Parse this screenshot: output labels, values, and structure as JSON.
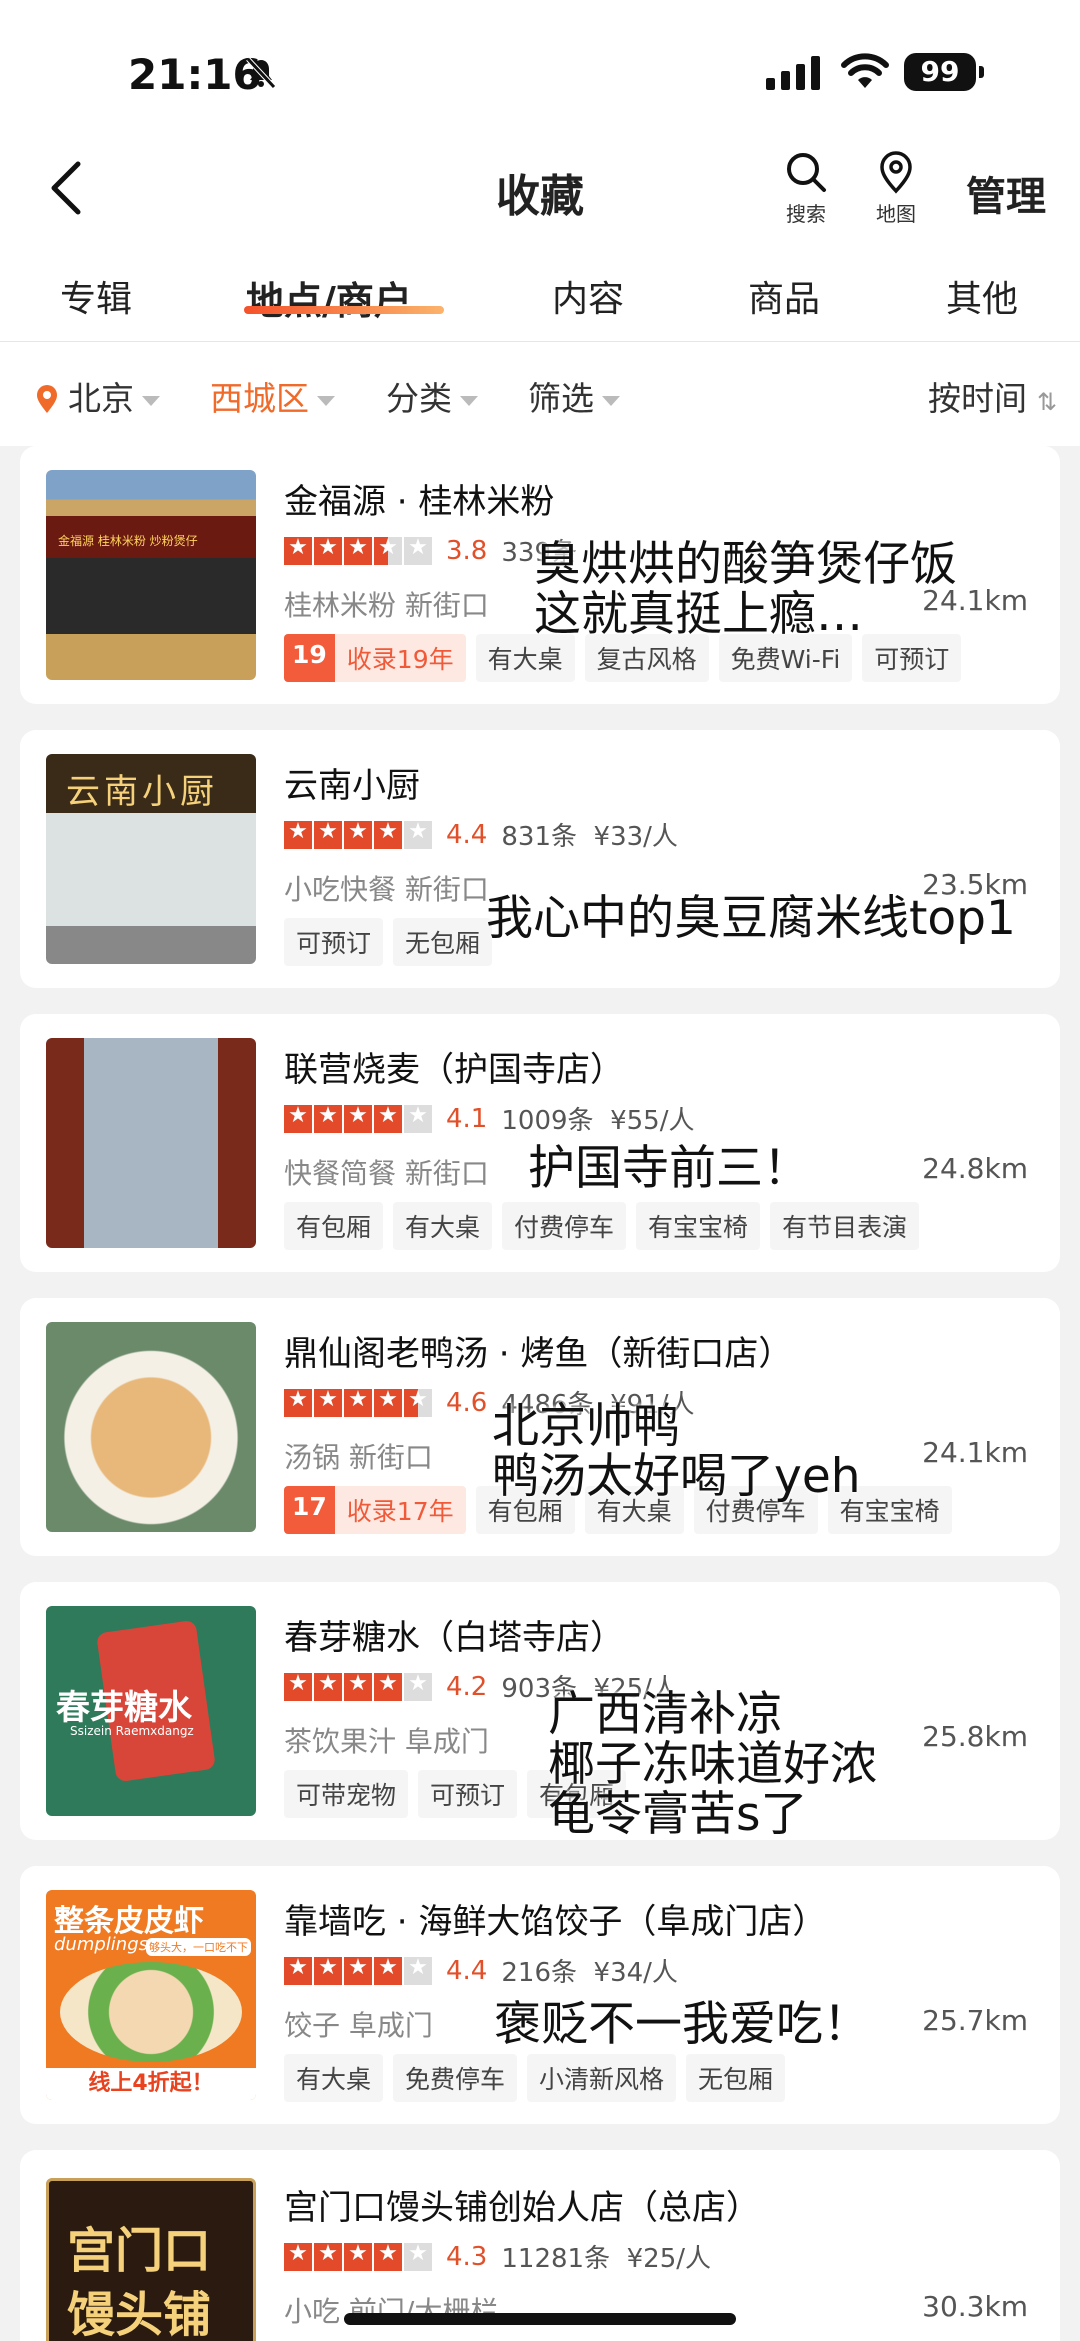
{
  "status": {
    "time": "21:16",
    "battery": "99"
  },
  "nav": {
    "title": "收藏",
    "search_label": "搜索",
    "map_label": "地图",
    "manage_label": "管理"
  },
  "tabs": [
    "专辑",
    "地点/商户",
    "内容",
    "商品",
    "其他"
  ],
  "active_tab": "地点/商户",
  "filters": {
    "city": "北京",
    "district": "西城区",
    "category": "分类",
    "filter": "筛选",
    "sort": "按时间"
  },
  "accent_color": "#f06a2a",
  "shops": [
    {
      "name": "金福源 · 桂林米粉",
      "score": "3.8",
      "stars": 3.5,
      "reviews": "339条",
      "price": "",
      "category_area": "桂林米粉 新街口",
      "distance": "24.1km",
      "years_num": "19",
      "years_text": "收录19年",
      "tags": [
        "有大桌",
        "复古风格",
        "免费Wi-Fi",
        "可预订"
      ],
      "overlay": [
        "臭烘烘的酸笋煲仔饭",
        "这就真挺上瘾…"
      ]
    },
    {
      "name": "云南小厨",
      "score": "4.4",
      "stars": 4,
      "reviews": "831条",
      "price": "¥33/人",
      "category_area": "小吃快餐 新街口",
      "distance": "23.5km",
      "years_num": "",
      "years_text": "",
      "tags": [
        "可预订",
        "无包厢"
      ],
      "overlay": [
        "我心中的臭豆腐米线top1"
      ]
    },
    {
      "name": "联营烧麦（护国寺店）",
      "score": "4.1",
      "stars": 4,
      "reviews": "1009条",
      "price": "¥55/人",
      "category_area": "快餐简餐 新街口",
      "distance": "24.8km",
      "years_num": "",
      "years_text": "",
      "tags": [
        "有包厢",
        "有大桌",
        "付费停车",
        "有宝宝椅",
        "有节目表演"
      ],
      "overlay": [
        "护国寺前三！"
      ]
    },
    {
      "name": "鼎仙阁老鸭汤 · 烤鱼（新街口店）",
      "score": "4.6",
      "stars": 4.5,
      "reviews": "4486条",
      "price": "¥91/人",
      "category_area": "汤锅 新街口",
      "distance": "24.1km",
      "years_num": "17",
      "years_text": "收录17年",
      "tags": [
        "有包厢",
        "有大桌",
        "付费停车",
        "有宝宝椅"
      ],
      "overlay": [
        "北京帅鸭",
        "鸭汤太好喝了yeh"
      ]
    },
    {
      "name": "春芽糖水（白塔寺店）",
      "score": "4.2",
      "stars": 4,
      "reviews": "903条",
      "price": "¥25/人",
      "category_area": "茶饮果汁 阜成门",
      "distance": "25.8km",
      "years_num": "",
      "years_text": "",
      "tags": [
        "可带宠物",
        "可预订",
        "有包厢"
      ],
      "overlay": [
        "广西清补凉",
        "椰子冻味道好浓",
        "龟苓膏苦s了"
      ]
    },
    {
      "name": "靠墙吃 · 海鲜大馅饺子（阜成门店）",
      "score": "4.4",
      "stars": 4,
      "reviews": "216条",
      "price": "¥34/人",
      "category_area": "饺子 阜成门",
      "distance": "25.7km",
      "years_num": "",
      "years_text": "",
      "tags": [
        "有大桌",
        "免费停车",
        "小清新风格",
        "无包厢"
      ],
      "overlay": [
        "褒贬不一我爱吃！"
      ]
    },
    {
      "name": "宫门口馒头铺创始人店（总店）",
      "score": "4.3",
      "stars": 4,
      "reviews": "11281条",
      "price": "¥25/人",
      "category_area": "小吃 前门/大栅栏",
      "distance": "30.3km",
      "years_num": "",
      "years_text": "",
      "tags": [],
      "overlay": []
    }
  ],
  "thumb_texts": {
    "shop0": "金福源 桂林米粉 炒粉煲仔",
    "shop1": "云南小厨",
    "shop4_main": "春芽糖水",
    "shop4_sub": "Ssizein Raemxdangz",
    "shop5_top": "整条皮皮虾",
    "shop5_dump": "dumplings",
    "shop5_slogan": "够头大，一口吃不下",
    "shop5_promo": "线上4折起！",
    "shop6_a": "宫门口",
    "shop6_b": "馒头铺"
  }
}
